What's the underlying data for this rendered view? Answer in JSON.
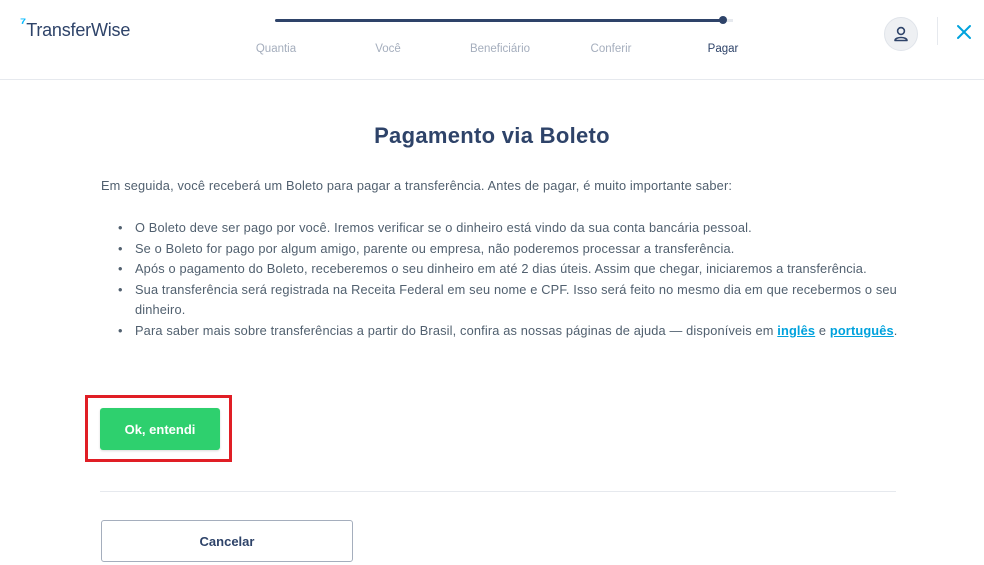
{
  "brand": {
    "flag": "⁷",
    "name": "TransferWise"
  },
  "steps": [
    {
      "label": "Quantia"
    },
    {
      "label": "Você"
    },
    {
      "label": "Beneficiário"
    },
    {
      "label": "Conferir"
    },
    {
      "label": "Pagar"
    }
  ],
  "active_step": "Pagar",
  "progress": 1.0,
  "header": {
    "avatar_icon": "user-icon",
    "close_icon": "close-icon"
  },
  "main": {
    "title": "Pagamento via Boleto",
    "intro": "Em seguida, você receberá um Boleto para pagar a transferência. Antes de pagar, é muito importante saber:",
    "bullets": [
      "O Boleto deve ser pago por você. Iremos verificar se o dinheiro está vindo da sua conta bancária pessoal.",
      "Se o Boleto for pago por algum amigo, parente ou empresa, não poderemos processar a transferência.",
      "Após o pagamento do Boleto, receberemos o seu dinheiro em até 2 dias úteis. Assim que chegar, iniciaremos a transferência.",
      "Sua transferência será registrada na Receita Federal em seu nome e CPF. Isso será feito no mesmo dia em que recebermos o seu dinheiro."
    ],
    "help_bullet": {
      "text_before": "Para saber mais sobre transferências a partir do Brasil, confira as nossas páginas de ajuda — disponíveis em ",
      "link_en": "inglês",
      "text_mid": " e ",
      "link_pt": "português",
      "text_after": "."
    },
    "ok_label": "Ok, entendi",
    "cancel_label": "Cancelar"
  },
  "colors": {
    "navy": "#2e4369",
    "green": "#2ed06e",
    "link": "#00a2dd",
    "highlight": "#e01e25",
    "brand_flag": "#00b9ff"
  }
}
